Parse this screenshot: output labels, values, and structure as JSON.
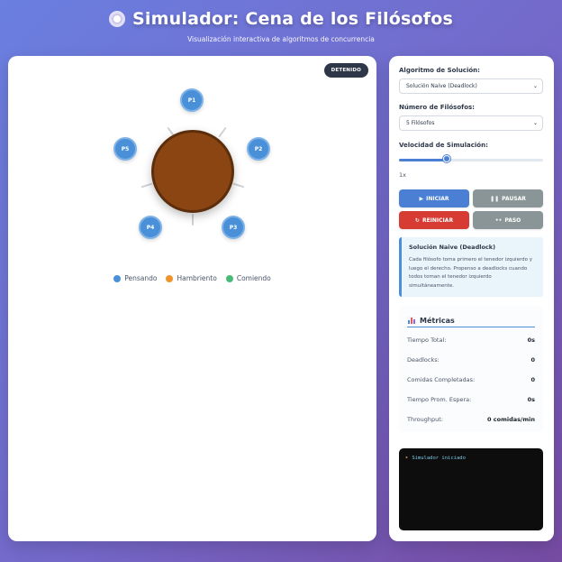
{
  "header": {
    "icon": "plate-icon",
    "title": "Simulador: Cena de los Filósofos",
    "subtitle": "Visualización interactiva de algoritmos de concurrencia"
  },
  "simulation": {
    "status": "DETENIDO",
    "philosophers": [
      {
        "label": "P1",
        "state": "Pensando"
      },
      {
        "label": "P2",
        "state": "Pensando"
      },
      {
        "label": "P3",
        "state": "Pensando"
      },
      {
        "label": "P4",
        "state": "Pensando"
      },
      {
        "label": "P5",
        "state": "Pensando"
      }
    ],
    "legend": [
      {
        "label": "Pensando",
        "color": "#4a90d9"
      },
      {
        "label": "Hambriento",
        "color": "#f0932b"
      },
      {
        "label": "Comiendo",
        "color": "#48bb78"
      }
    ],
    "colors": {
      "table": "#8b4513",
      "fork": "#cfd2d6",
      "thinking": "#4a90d9"
    }
  },
  "controls": {
    "algorithm_label": "Algoritmo de Solución:",
    "algorithm_value": "Solución Naive (Deadlock)",
    "philosophers_label": "Número de Filósofos:",
    "philosophers_value": "5 Filósofos",
    "speed_label": "Velocidad de Simulación:",
    "speed_value": "1x",
    "speed_fraction": 0.33,
    "buttons": {
      "start": "INICIAR",
      "pause": "PAUSAR",
      "reset": "REINICIAR",
      "step": "PASO"
    },
    "button_icons": {
      "start": "play-icon",
      "pause": "pause-icon",
      "reset": "reset-icon",
      "step": "footsteps-icon"
    },
    "button_colors": {
      "start": "#4a7fd4",
      "pause": "#8a9597",
      "reset": "#d63b34",
      "step": "#8a9597"
    }
  },
  "info": {
    "title": "Solución Naive (Deadlock)",
    "text": "Cada filósofo toma primero el tenedor izquierdo y luego el derecho. Propenso a deadlocks cuando todos toman el tenedor izquierdo simultáneamente."
  },
  "metrics": {
    "title": "Métricas",
    "rows": [
      {
        "label": "Tiempo Total:",
        "value": "0s"
      },
      {
        "label": "Deadlocks:",
        "value": "0"
      },
      {
        "label": "Comidas Completadas:",
        "value": "0"
      },
      {
        "label": "Tiempo Prom. Espera:",
        "value": "0s"
      },
      {
        "label": "Throughput:",
        "value": "0 comidas/min"
      }
    ]
  },
  "console": {
    "lines": [
      {
        "icon": "rocket-icon",
        "text": "Simulador iniciado"
      }
    ]
  }
}
